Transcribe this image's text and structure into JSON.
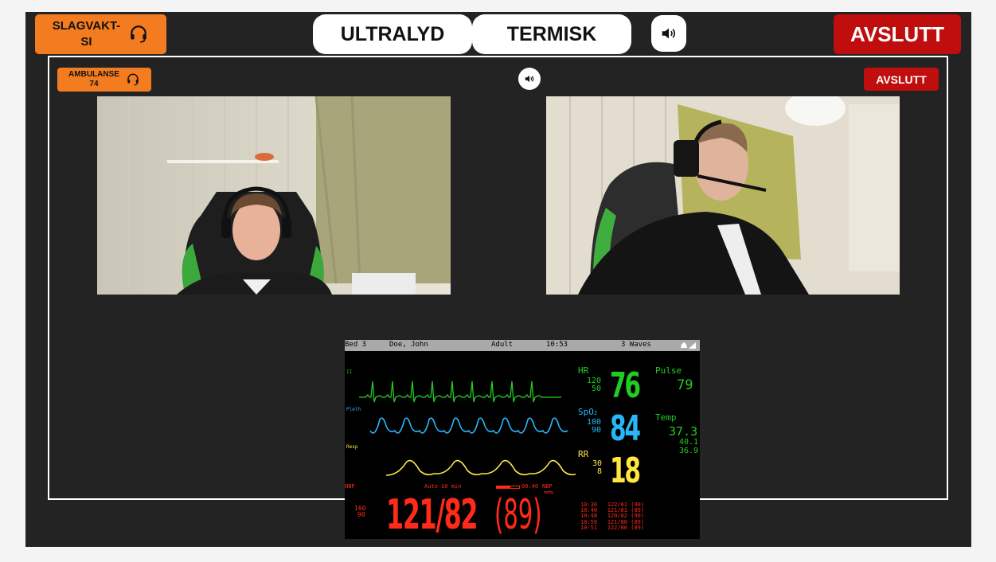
{
  "header": {
    "operator_label": "SLAGVAKT-\nSI",
    "tabs": [
      {
        "label": "ULTRALYD"
      },
      {
        "label": "TERMISK"
      }
    ],
    "end_label": "AVSLUTT"
  },
  "call": {
    "caller_label": "AMBULANSE\n74",
    "end_label": "AVSLUTT"
  },
  "monitor": {
    "bed": "Bed 3",
    "patient": "Doe, John",
    "mode": "Adult",
    "time": "10:53",
    "waves": "3 Waves",
    "lead_label": "II",
    "pleth_label": "Pleth",
    "resp_label": "Resp",
    "hr": {
      "label": "HR",
      "high": "120",
      "low": "50",
      "value": "76",
      "color": "#22cc22"
    },
    "spo2": {
      "label": "SpO",
      "sub": "2",
      "high": "100",
      "low": "90",
      "value": "84",
      "color": "#29b6f6"
    },
    "rr": {
      "label": "RR",
      "high": "30",
      "low": "8",
      "value": "18",
      "color": "#ffe640"
    },
    "pulse": {
      "label": "Pulse",
      "value": "79"
    },
    "temp": {
      "label": "Temp",
      "value": "37.3",
      "v2": "40.1",
      "v3": "36.9"
    },
    "nbp": {
      "label": "NBP",
      "auto": "Auto 10 min",
      "last_time": "00:40",
      "last_label": "NBP",
      "unit": "mmHg",
      "high": "160",
      "low": "90",
      "value": "121/82",
      "mean": "(89)",
      "color": "#ff2a1a"
    },
    "history": [
      {
        "time": "10:30",
        "value": "122/81 (90)"
      },
      {
        "time": "10:40",
        "value": "121/81 (89)"
      },
      {
        "time": "10:48",
        "value": "120/82 (90)"
      },
      {
        "time": "10:50",
        "value": "121/80 (89)"
      },
      {
        "time": "10:51",
        "value": "122/80 (89)"
      }
    ]
  }
}
